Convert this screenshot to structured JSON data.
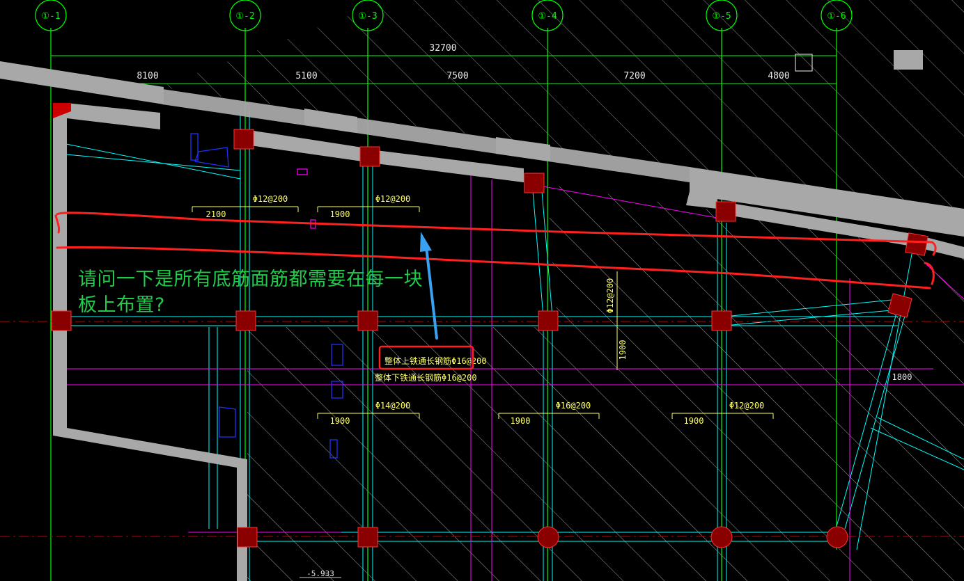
{
  "axes": [
    "①-1",
    "①-2",
    "①-3",
    "①-4",
    "①-5",
    "①-6"
  ],
  "total_dimension": "32700",
  "span_dimensions": [
    "8100",
    "5100",
    "7500",
    "7200",
    "4800"
  ],
  "rebar_top_row": [
    {
      "spec": "Φ12@200",
      "length": "2100"
    },
    {
      "spec": "Φ12@200",
      "length": "1900"
    }
  ],
  "rebar_vertical": {
    "spec": "Φ12@200",
    "length": "1900"
  },
  "rebar_bottom_row": [
    {
      "spec": "Φ14@200",
      "length": "1900"
    },
    {
      "spec": "Φ16@200",
      "length": "1900"
    },
    {
      "spec": "Φ12@200",
      "length": "1900"
    }
  ],
  "right_dimension": "1800",
  "highlighted_note": "整体上铁通长钢筋Φ16@200",
  "lower_note": "整体下铁通长钢筋Φ16@200",
  "elevation": "-5.933",
  "question_text": "请问一下是所有底筋面筋都需要在每一块板上布置?",
  "colors": {
    "background": "#000000",
    "grid": "#00ff00",
    "cyan": "#00ffff",
    "magenta": "#ff00ff",
    "markup_red": "#ff2020",
    "arrow_blue": "#3aa0f0",
    "question_green": "#22c94a"
  }
}
